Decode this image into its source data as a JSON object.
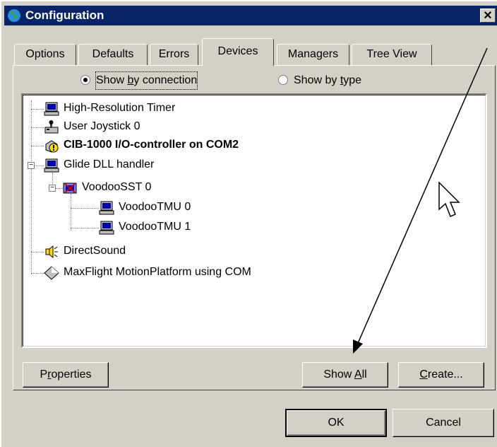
{
  "window": {
    "title": "Configuration",
    "close_label": "✕"
  },
  "tabs": [
    {
      "label": "Options"
    },
    {
      "label": "Defaults"
    },
    {
      "label": "Errors"
    },
    {
      "label": "Devices",
      "active": true
    },
    {
      "label": "Managers"
    },
    {
      "label": "Tree View"
    }
  ],
  "view_mode": {
    "by_connection": {
      "pre": "Show ",
      "accel": "b",
      "post": "y connection",
      "selected": true
    },
    "by_type": {
      "pre": "Show by ",
      "accel": "t",
      "post": "ype",
      "selected": false
    }
  },
  "tree": {
    "items": [
      {
        "label": "High-Resolution Timer",
        "icon": "computer-icon"
      },
      {
        "label": "User Joystick 0",
        "icon": "joystick-icon"
      },
      {
        "label": "CIB-1000 I/O-controller on COM2",
        "icon": "warning-device-icon",
        "bold": true
      },
      {
        "label": "Glide DLL handler",
        "icon": "computer-icon",
        "expanded": true
      },
      {
        "label": "VoodooSST 0",
        "icon": "3d-card-icon",
        "expanded": true
      },
      {
        "label": "VoodooTMU 0",
        "icon": "computer-icon"
      },
      {
        "label": "VoodooTMU 1",
        "icon": "computer-icon"
      },
      {
        "label": "DirectSound",
        "icon": "speaker-icon"
      },
      {
        "label": "MaxFlight MotionPlatform using COM",
        "icon": "diamond-icon"
      }
    ]
  },
  "buttons": {
    "properties": {
      "pre": "P",
      "accel": "r",
      "post": "operties"
    },
    "show_all": {
      "pre": "Show ",
      "accel": "A",
      "post": "ll"
    },
    "create": {
      "pre": "",
      "accel": "C",
      "post": "reate..."
    },
    "ok": "OK",
    "cancel": "Cancel"
  },
  "colors": {
    "title_bar": "#0a246a",
    "face": "#d4d0c8",
    "tree_background": "#ffffff"
  }
}
